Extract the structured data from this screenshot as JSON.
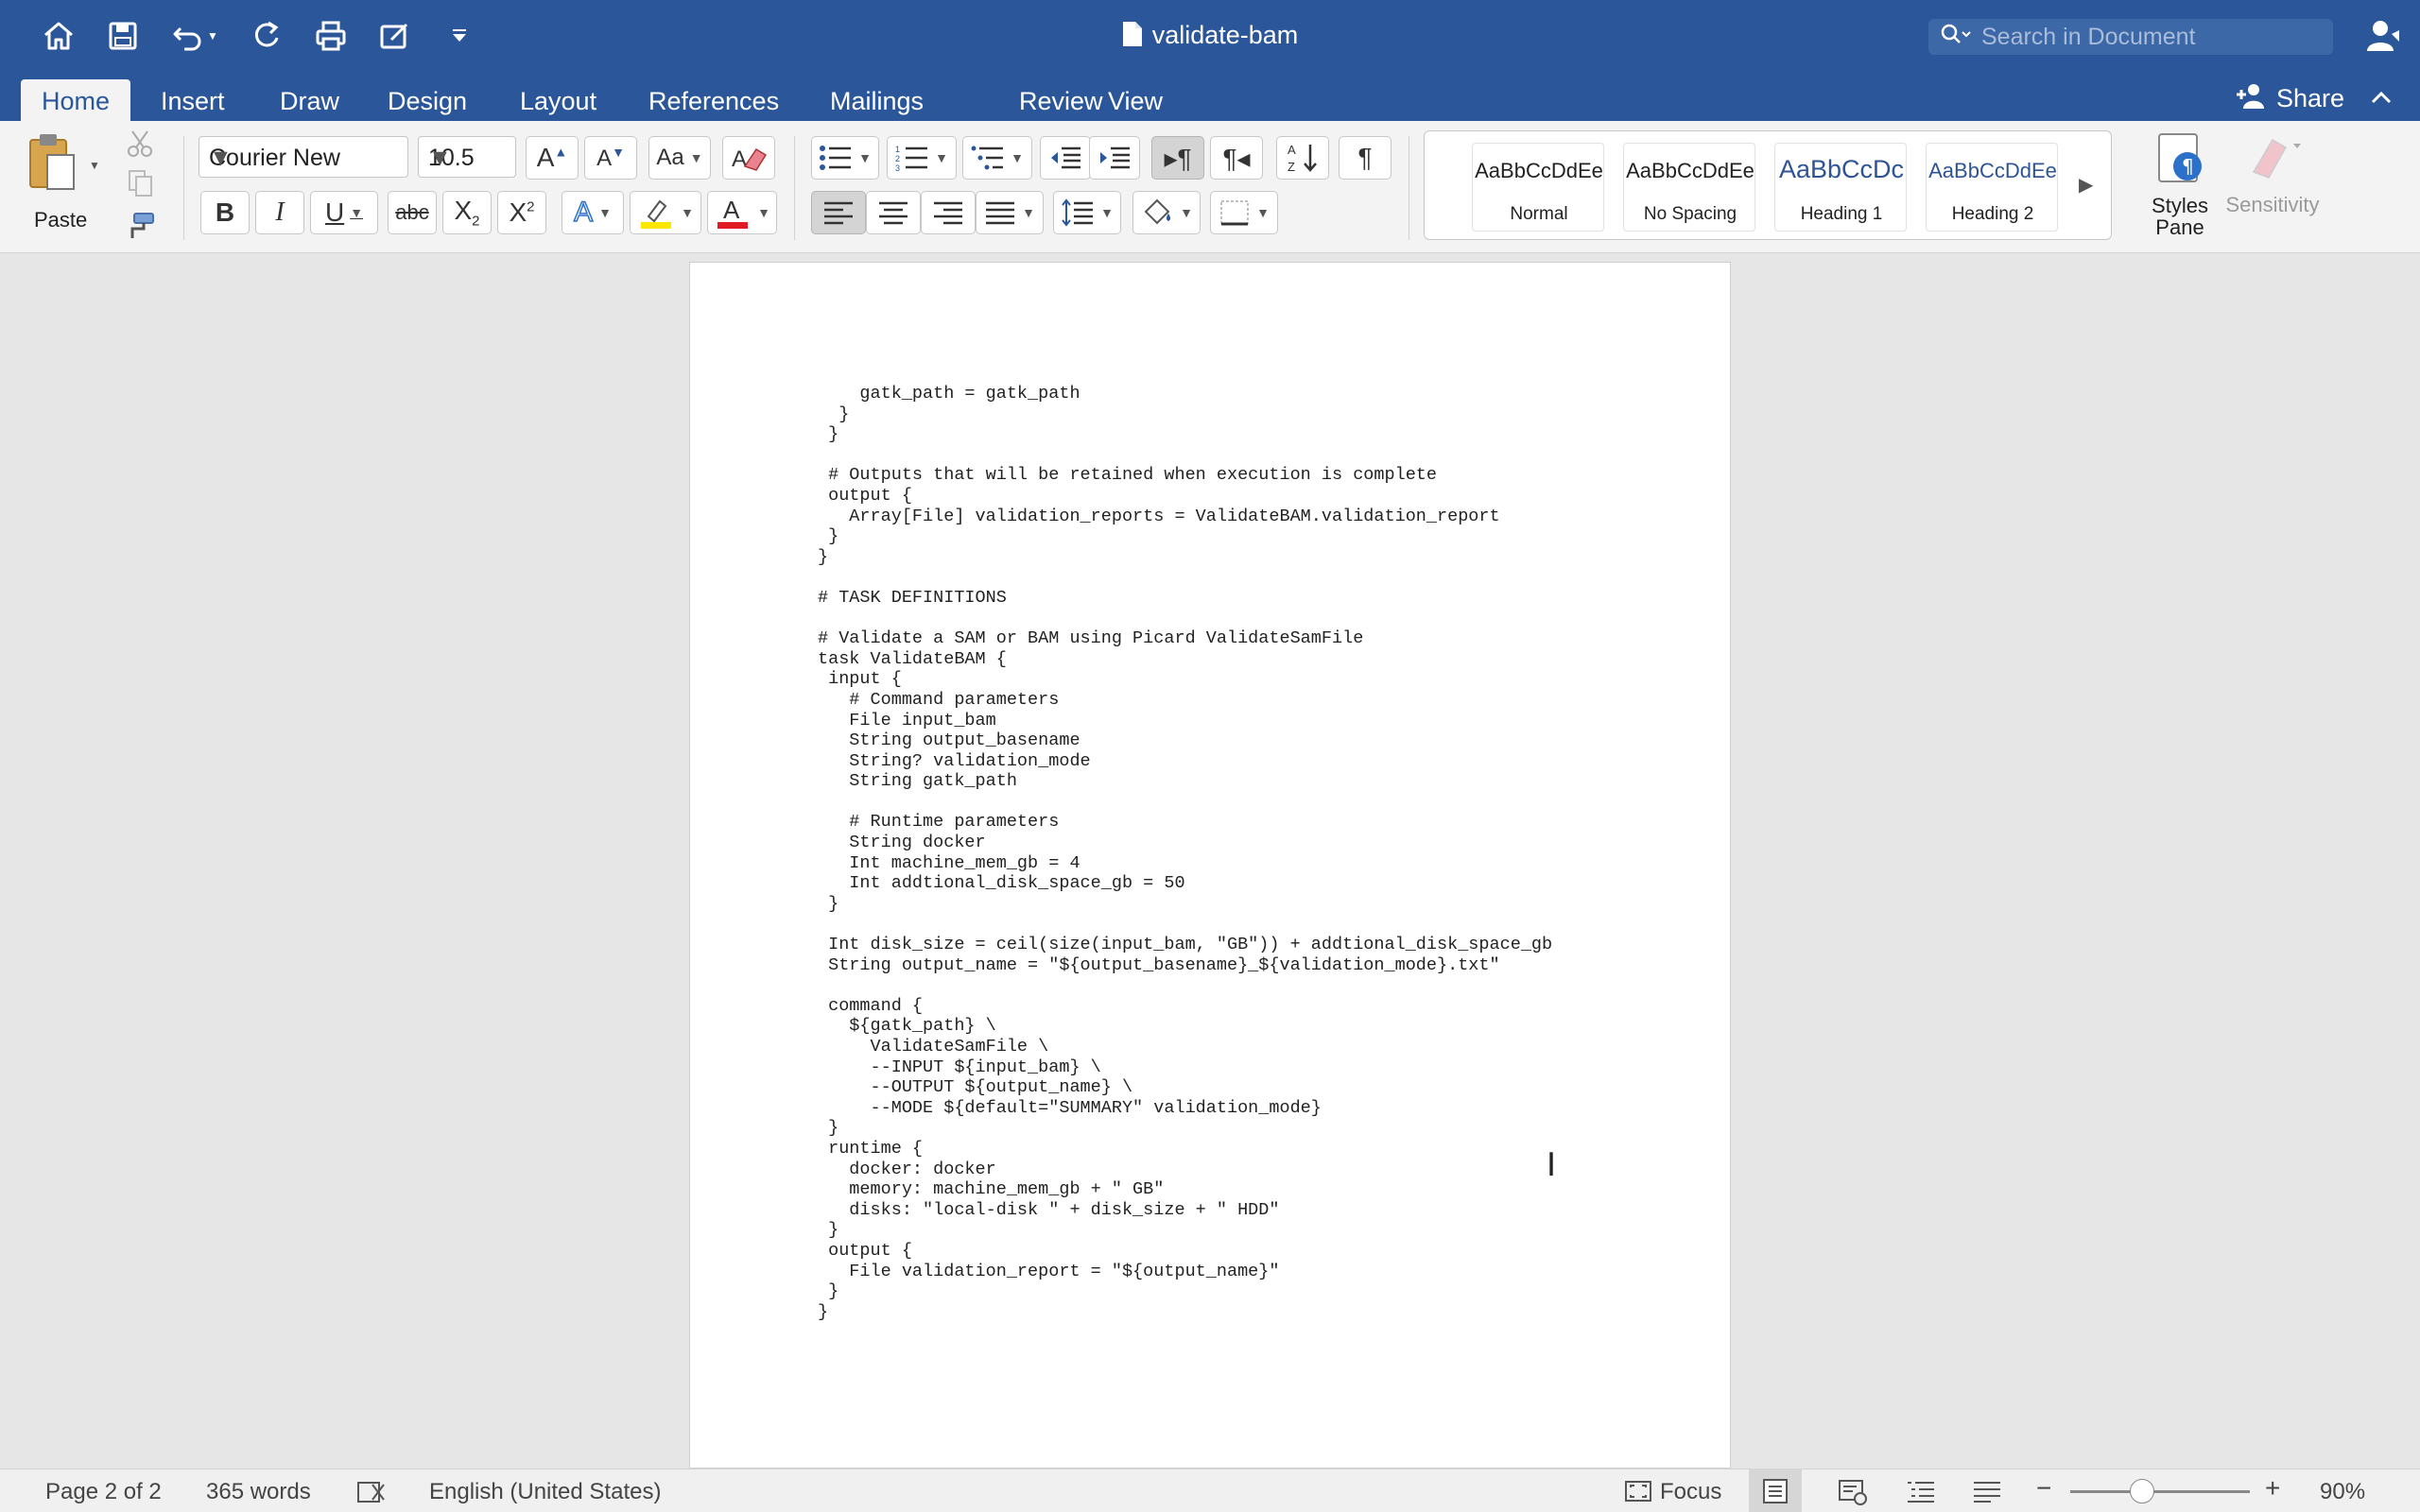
{
  "window": {
    "title": "validate-bam",
    "search_placeholder": "Search in Document"
  },
  "quick_access": [
    "home-icon",
    "save-icon",
    "undo-icon",
    "redo-icon",
    "print-icon",
    "edit-icon",
    "customize-icon"
  ],
  "tabs": [
    "Home",
    "Insert",
    "Draw",
    "Design",
    "Layout",
    "References",
    "Mailings",
    "Review",
    "View"
  ],
  "share_label": "Share",
  "ribbon": {
    "paste_label": "Paste",
    "font_name": "Courier New",
    "font_size": "10.5",
    "styles": [
      {
        "preview": "AaBbCcDdEe",
        "name": "Normal"
      },
      {
        "preview": "AaBbCcDdEe",
        "name": "No Spacing"
      },
      {
        "preview": "AaBbCcDc",
        "name": "Heading 1"
      },
      {
        "preview": "AaBbCcDdEe",
        "name": "Heading 2"
      }
    ],
    "styles_pane_label": "Styles Pane",
    "sensitivity_label": "Sensitivity"
  },
  "document": {
    "lines": [
      "    gatk_path = gatk_path",
      "  }",
      " }",
      "",
      " # Outputs that will be retained when execution is complete",
      " output {",
      "   Array[File] validation_reports = ValidateBAM.validation_report",
      " }",
      "}",
      "",
      "# TASK DEFINITIONS",
      "",
      "# Validate a SAM or BAM using Picard ValidateSamFile",
      "task ValidateBAM {",
      " input {",
      "   # Command parameters",
      "   File input_bam",
      "   String output_basename",
      "   String? validation_mode",
      "   String gatk_path",
      "",
      "   # Runtime parameters",
      "   String docker",
      "   Int machine_mem_gb = 4",
      "   Int addtional_disk_space_gb = 50",
      " }",
      "",
      " Int disk_size = ceil(size(input_bam, \"GB\")) + addtional_disk_space_gb",
      " String output_name = \"${output_basename}_${validation_mode}.txt\"",
      "",
      " command {",
      "   ${gatk_path} \\",
      "     ValidateSamFile \\",
      "     --INPUT ${input_bam} \\",
      "     --OUTPUT ${output_name} \\",
      "     --MODE ${default=\"SUMMARY\" validation_mode}",
      " }",
      " runtime {",
      "   docker: docker",
      "   memory: machine_mem_gb + \" GB\"",
      "   disks: \"local-disk \" + disk_size + \" HDD\"",
      " }",
      " output {",
      "   File validation_report = \"${output_name}\"",
      " }",
      "}"
    ]
  },
  "status": {
    "page": "Page 2 of 2",
    "words": "365 words",
    "language": "English (United States)",
    "focus": "Focus",
    "zoom": "90%",
    "zoom_fraction": 0.4
  }
}
